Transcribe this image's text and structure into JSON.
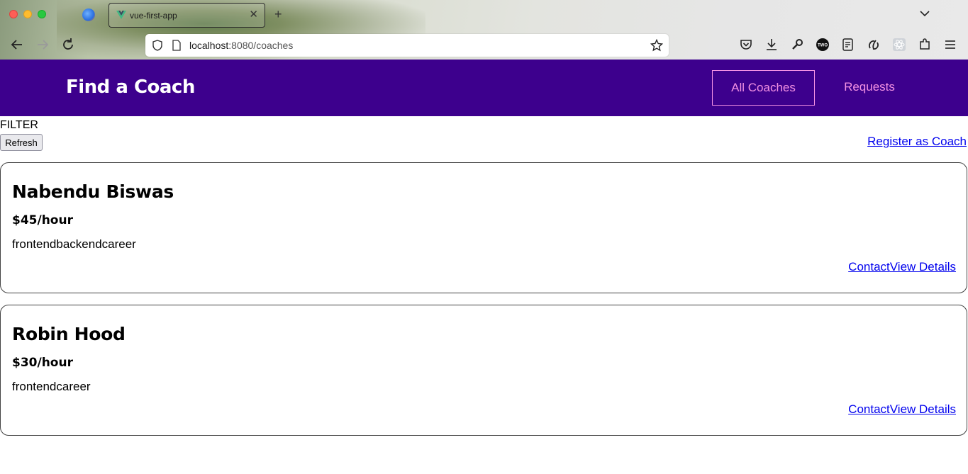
{
  "browser": {
    "tab_title": "vue-first-app",
    "new_tab_symbol": "+",
    "close_symbol": "✕",
    "url_host": "localhost",
    "url_rest": ":8080/coaches",
    "icons": [
      "back-icon",
      "forward-icon",
      "reload-icon",
      "shield-icon",
      "page-icon",
      "bookmark-star-icon",
      "pocket-icon",
      "downloads-icon",
      "wrench-icon",
      "two-extension-icon",
      "reader-list-icon",
      "redux-extension-icon",
      "react-extension-icon",
      "extensions-icon",
      "menu-icon"
    ]
  },
  "header": {
    "brand": "Find a Coach",
    "nav": {
      "all_coaches": "All Coaches",
      "requests": "Requests"
    },
    "background_color": "#3d008d",
    "link_color": "#f391e3"
  },
  "filter": {
    "label": "FILTER",
    "refresh_button": "Refresh",
    "register_link": "Register as Coach"
  },
  "coaches": [
    {
      "name": "Nabendu Biswas",
      "rate": "$45/hour",
      "areas": "frontendbackendcareer",
      "contact": "Contact",
      "details": "View Details"
    },
    {
      "name": "Robin Hood",
      "rate": "$30/hour",
      "areas": "frontendcareer",
      "contact": "Contact",
      "details": "View Details"
    }
  ]
}
